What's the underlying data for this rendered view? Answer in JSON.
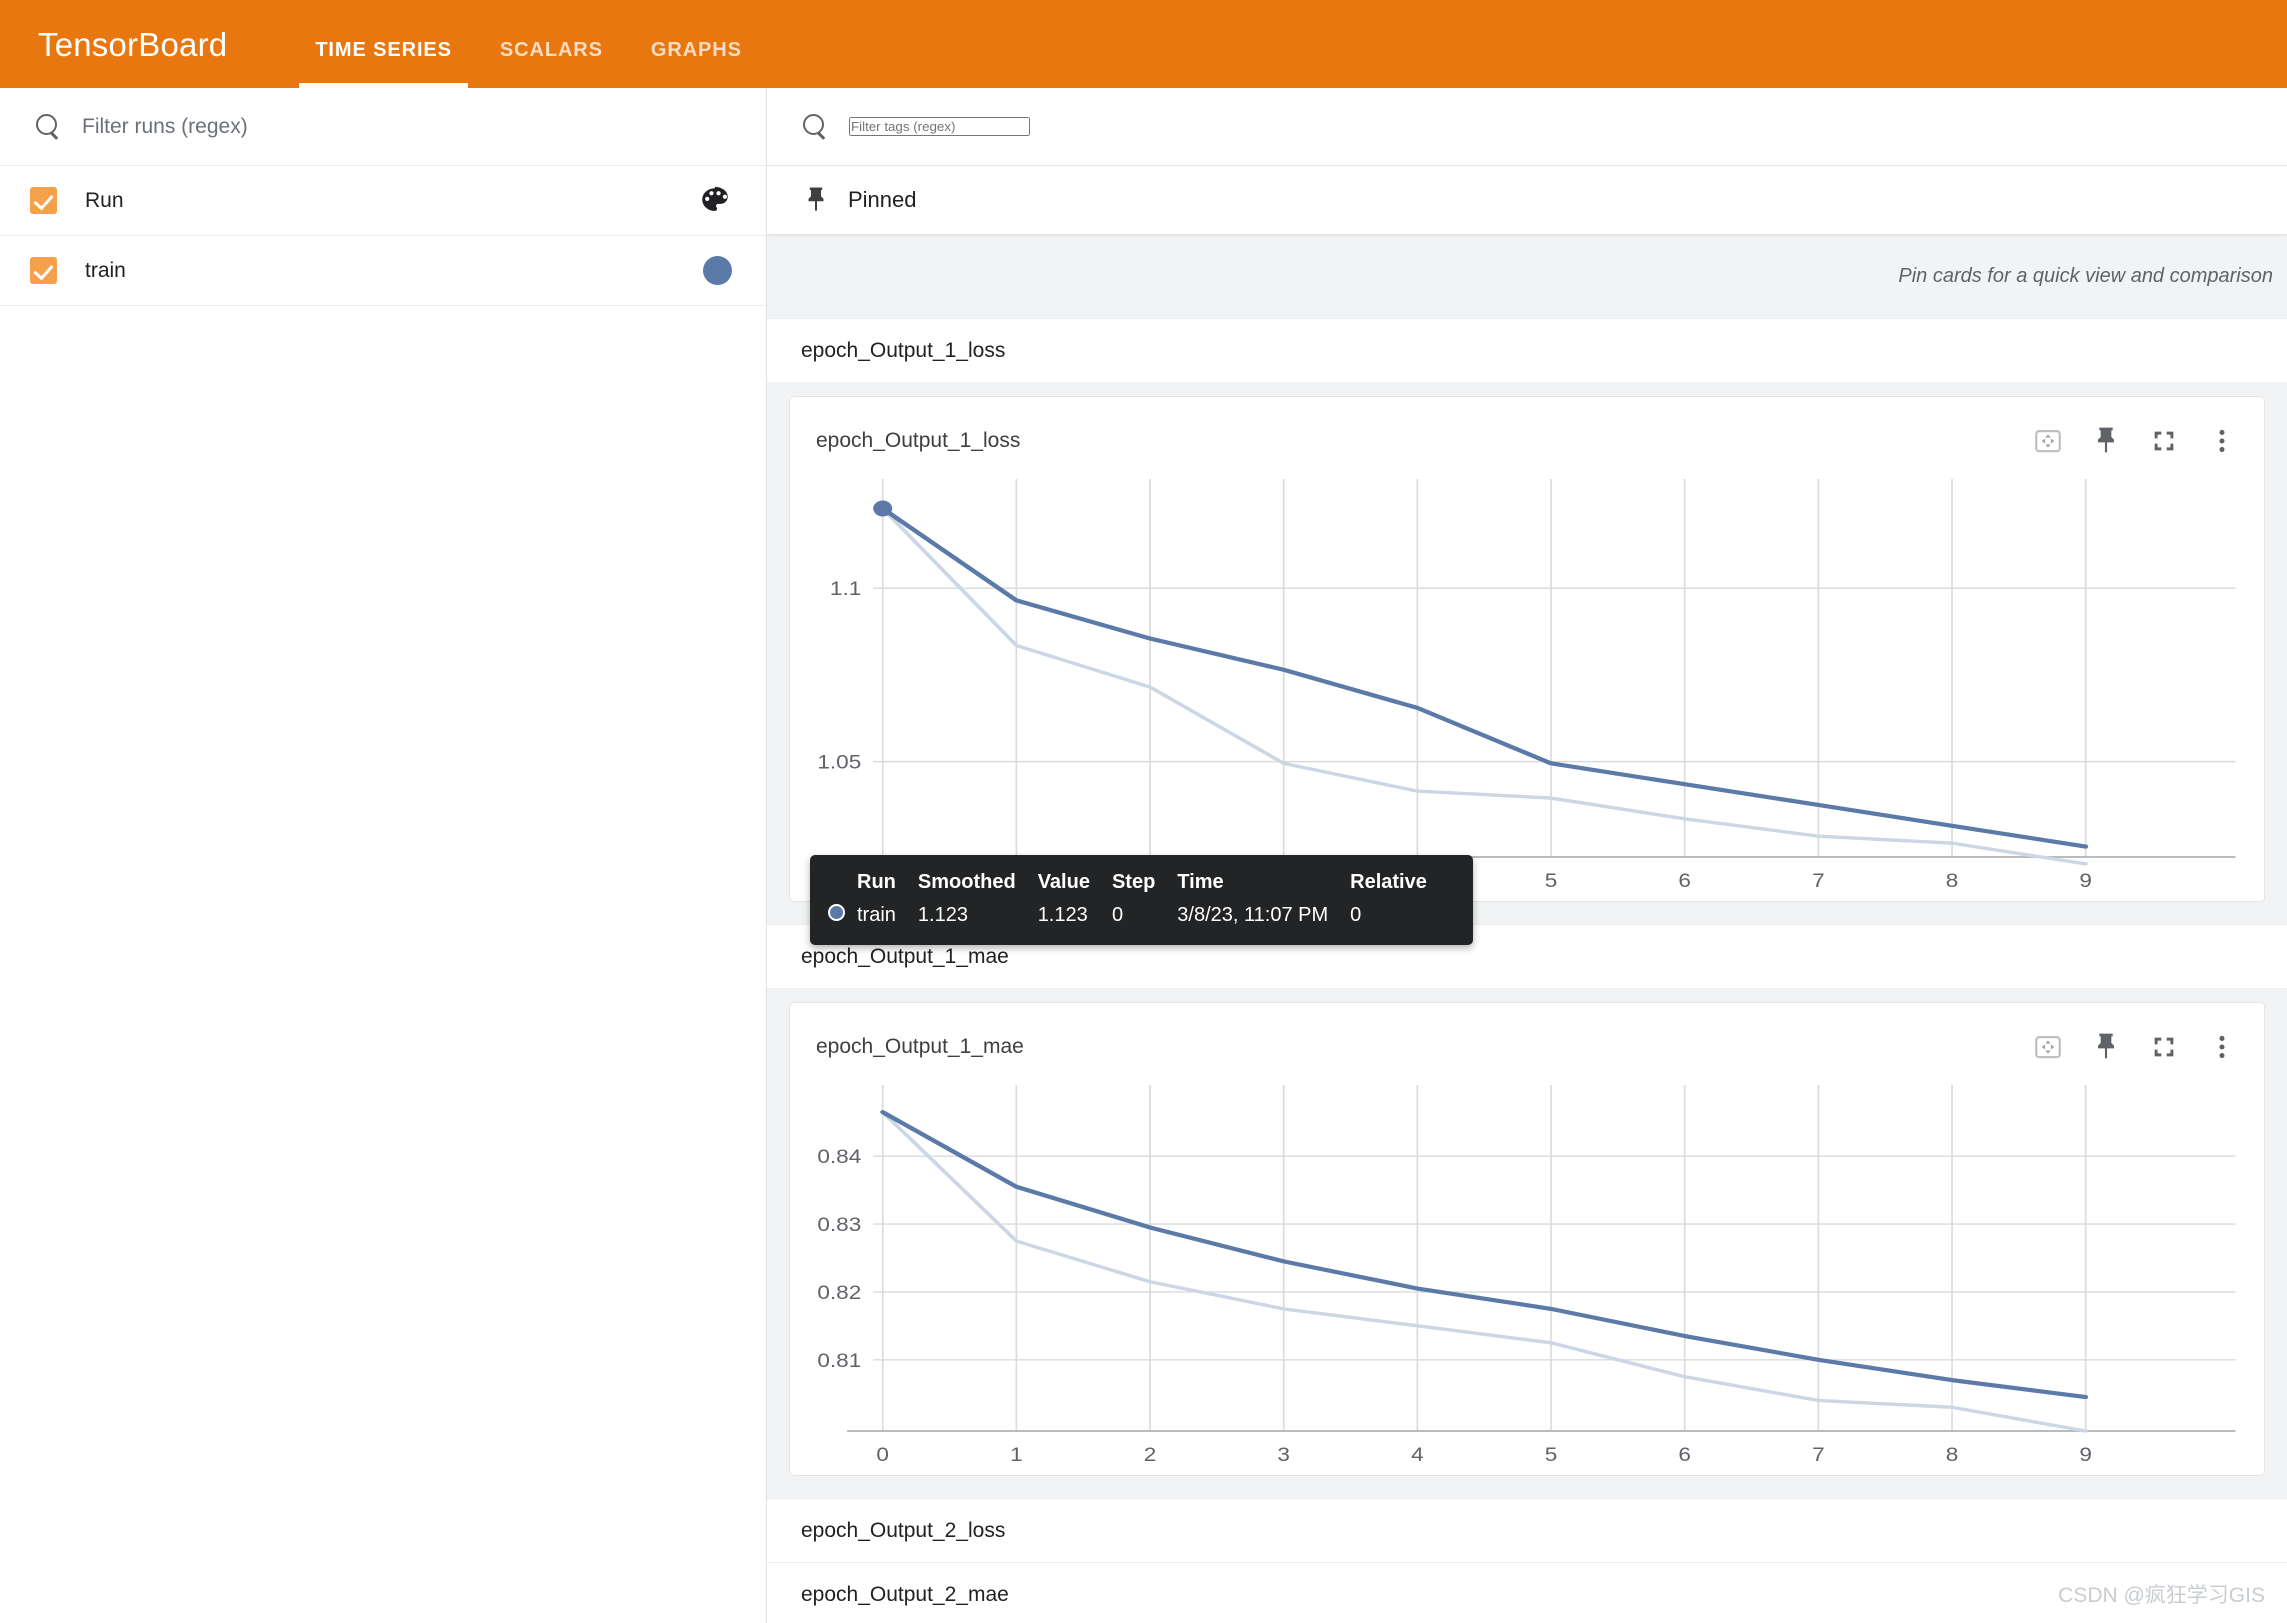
{
  "app": {
    "brand": "TensorBoard",
    "accent_color": "#e8770f",
    "series_color": "#5b7aa8",
    "series_color_faded": "#ccd6e5"
  },
  "tabs": [
    {
      "label": "TIME SERIES",
      "active": true
    },
    {
      "label": "SCALARS",
      "active": false
    },
    {
      "label": "GRAPHS",
      "active": false
    }
  ],
  "sidebar": {
    "search": {
      "placeholder": "Filter runs (regex)",
      "value": "",
      "icon": "search-icon"
    },
    "header_row": {
      "label": "Run",
      "checked": true,
      "icon": "palette-icon"
    },
    "runs": [
      {
        "label": "train",
        "checked": true,
        "color": "#5b7aa8"
      }
    ]
  },
  "main": {
    "tag_search": {
      "placeholder": "Filter tags (regex)",
      "value": "",
      "icon": "search-icon"
    },
    "pinned": {
      "label": "Pinned",
      "icon": "pin-icon"
    },
    "pin_hint": "Pin cards for a quick view and comparison",
    "card_actions": [
      {
        "name": "fit-view-icon",
        "label": "Fit domain to data"
      },
      {
        "name": "pin-icon",
        "label": "Pin card"
      },
      {
        "name": "fullscreen-icon",
        "label": "Toggle fullscreen"
      },
      {
        "name": "more-vert-icon",
        "label": "More options"
      }
    ],
    "groups": [
      {
        "label": "epoch_Output_1_loss",
        "expanded": true
      },
      {
        "label": "epoch_Output_1_mae",
        "expanded": true
      },
      {
        "label": "epoch_Output_2_loss",
        "expanded": false
      },
      {
        "label": "epoch_Output_2_mae",
        "expanded": false
      }
    ]
  },
  "tooltip": {
    "headers": [
      "Run",
      "Smoothed",
      "Value",
      "Step",
      "Time",
      "Relative"
    ],
    "rows": [
      {
        "run": "train",
        "smoothed": "1.123",
        "value": "1.123",
        "step": "0",
        "time": "3/8/23, 11:07 PM",
        "relative": "0",
        "color": "#5b7aa8"
      }
    ]
  },
  "watermark": "CSDN @疯狂学习GIS",
  "chart_data": [
    {
      "type": "line",
      "title": "epoch_Output_1_loss",
      "xlabel": "",
      "ylabel": "",
      "x": [
        0,
        1,
        2,
        3,
        4,
        5,
        6,
        7,
        8,
        9
      ],
      "xlim": [
        0,
        9
      ],
      "ylim": [
        1.0225,
        1.1315
      ],
      "xticks": [
        "0",
        "1",
        "2",
        "3",
        "4",
        "5",
        "6",
        "7",
        "8",
        "9"
      ],
      "yticks": [
        "1.1",
        "1.05"
      ],
      "ytick_values": [
        1.1,
        1.05
      ],
      "grid": true,
      "legend": "none",
      "series": [
        {
          "name": "train (smoothed)",
          "color": "#5b7aa8",
          "values": [
            1.123,
            1.0965,
            1.0855,
            1.0765,
            1.0655,
            1.0495,
            1.0435,
            1.0375,
            1.0315,
            1.0255
          ]
        },
        {
          "name": "train",
          "color": "#ccd6e5",
          "values": [
            1.123,
            1.0835,
            1.0715,
            1.0495,
            1.0415,
            1.0395,
            1.0335,
            1.0285,
            1.0265,
            1.0205
          ]
        }
      ],
      "highlight_point": {
        "x": 0,
        "y": 1.123,
        "series": "train (smoothed)"
      }
    },
    {
      "type": "line",
      "title": "epoch_Output_1_mae",
      "xlabel": "",
      "ylabel": "",
      "x": [
        0,
        1,
        2,
        3,
        4,
        5,
        6,
        7,
        8,
        9
      ],
      "xlim": [
        0,
        9
      ],
      "ylim": [
        0.7995,
        0.8505
      ],
      "xticks": [
        "0",
        "1",
        "2",
        "3",
        "4",
        "5",
        "6",
        "7",
        "8",
        "9"
      ],
      "yticks": [
        "0.84",
        "0.83",
        "0.82",
        "0.81"
      ],
      "ytick_values": [
        0.84,
        0.83,
        0.82,
        0.81
      ],
      "grid": true,
      "legend": "none",
      "series": [
        {
          "name": "train (smoothed)",
          "color": "#5b7aa8",
          "values": [
            0.8465,
            0.8355,
            0.8295,
            0.8245,
            0.8205,
            0.8175,
            0.8135,
            0.81,
            0.807,
            0.8045
          ]
        },
        {
          "name": "train",
          "color": "#ccd6e5",
          "values": [
            0.8465,
            0.8275,
            0.8215,
            0.8175,
            0.815,
            0.8125,
            0.8075,
            0.804,
            0.803,
            0.7995
          ]
        }
      ]
    }
  ]
}
